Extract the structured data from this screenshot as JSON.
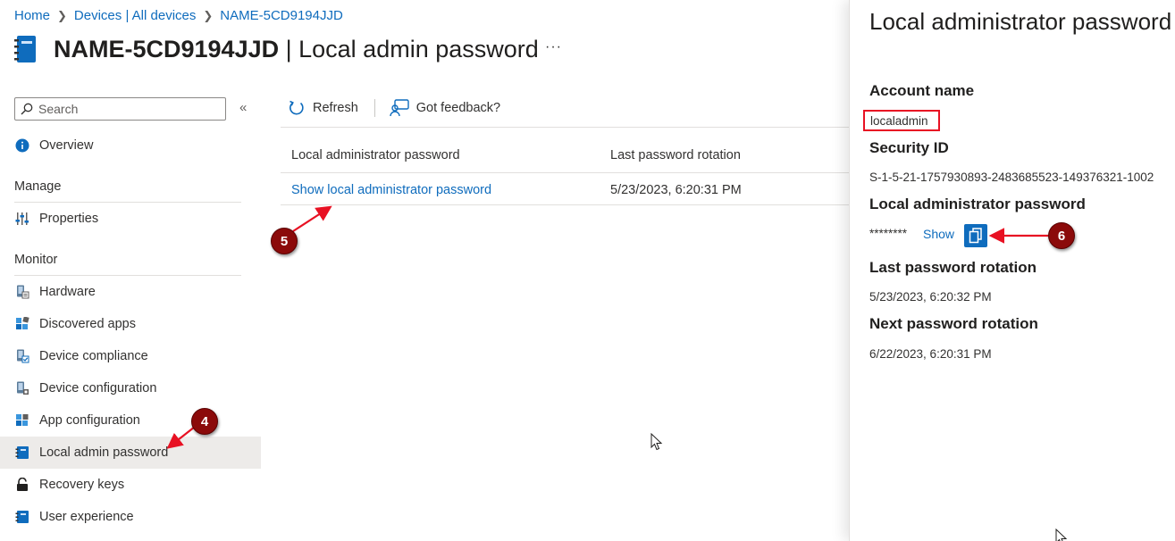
{
  "breadcrumb": {
    "home": "Home",
    "devices": "Devices | All devices",
    "device": "NAME-5CD9194JJD"
  },
  "page": {
    "title_bold": "NAME-5CD9194JJD",
    "title_rest": " | Local admin password",
    "more": "···"
  },
  "nav": {
    "search_placeholder": "Search",
    "collapse": "«",
    "overview": "Overview",
    "manage_header": "Manage",
    "properties": "Properties",
    "monitor_header": "Monitor",
    "hardware": "Hardware",
    "discovered_apps": "Discovered apps",
    "device_compliance": "Device compliance",
    "device_configuration": "Device configuration",
    "app_configuration": "App configuration",
    "local_admin_password": "Local admin password",
    "recovery_keys": "Recovery keys",
    "user_experience": "User experience"
  },
  "toolbar": {
    "refresh": "Refresh",
    "feedback": "Got feedback?"
  },
  "table": {
    "columns": [
      "Local administrator password",
      "Last password rotation"
    ],
    "rows": [
      {
        "password_link": "Show local administrator password",
        "rotation": "5/23/2023, 6:20:31 PM"
      }
    ]
  },
  "annotations": {
    "badge4": "4",
    "badge5": "5",
    "badge6": "6",
    "color": "#8b0a0a",
    "arrow_color": "#e81123"
  },
  "panel": {
    "title": "Local administrator password",
    "account_name_label": "Account name",
    "account_name": "localadmin",
    "security_id_label": "Security ID",
    "security_id": "S-1-5-21-1757930893-2483685523-149376321-1002",
    "password_label": "Local administrator password",
    "password_masked": "********",
    "show": "Show",
    "last_rotation_label": "Last password rotation",
    "last_rotation": "5/23/2023, 6:20:32 PM",
    "next_rotation_label": "Next password rotation",
    "next_rotation": "6/22/2023, 6:20:31 PM"
  },
  "colors": {
    "link": "#0f6cbd",
    "selected_bg": "#edebe9"
  }
}
